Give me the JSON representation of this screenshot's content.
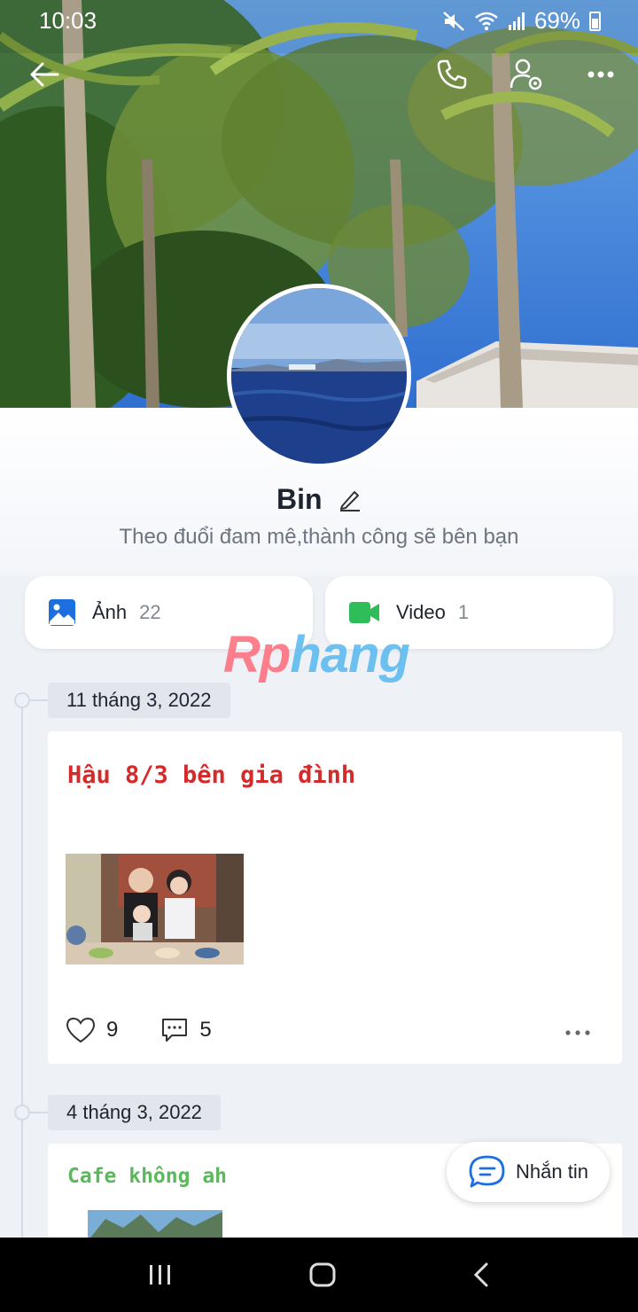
{
  "status_bar": {
    "time": "10:03",
    "battery_percent": "69%",
    "icons": [
      "mute-icon",
      "wifi-icon",
      "signal-icon",
      "battery-icon"
    ]
  },
  "top_nav": {
    "icons": [
      "back-arrow-icon",
      "phone-icon",
      "user-settings-icon",
      "more-icon"
    ]
  },
  "profile": {
    "name": "Bin",
    "bio": "Theo đuổi đam mê,thành công sẽ bên bạn"
  },
  "media": {
    "photos_label": "Ảnh",
    "photos_count": "22",
    "videos_label": "Video",
    "videos_count": "1"
  },
  "watermark": {
    "part1": "Rp",
    "part2": "hang"
  },
  "timeline": [
    {
      "date": "11 tháng 3, 2022",
      "title": "Hậu 8/3 bên gia đình",
      "title_color": "#d42a2a",
      "likes": "9",
      "comments": "5"
    },
    {
      "date": "4 tháng 3, 2022",
      "title": "Cafe không ah",
      "title_color": "#5cb85c"
    }
  ],
  "fab": {
    "label": "Nhắn tin"
  },
  "colors": {
    "accent_blue": "#1d6fe0",
    "video_green": "#2ebd59",
    "background": "#eef1f6"
  }
}
